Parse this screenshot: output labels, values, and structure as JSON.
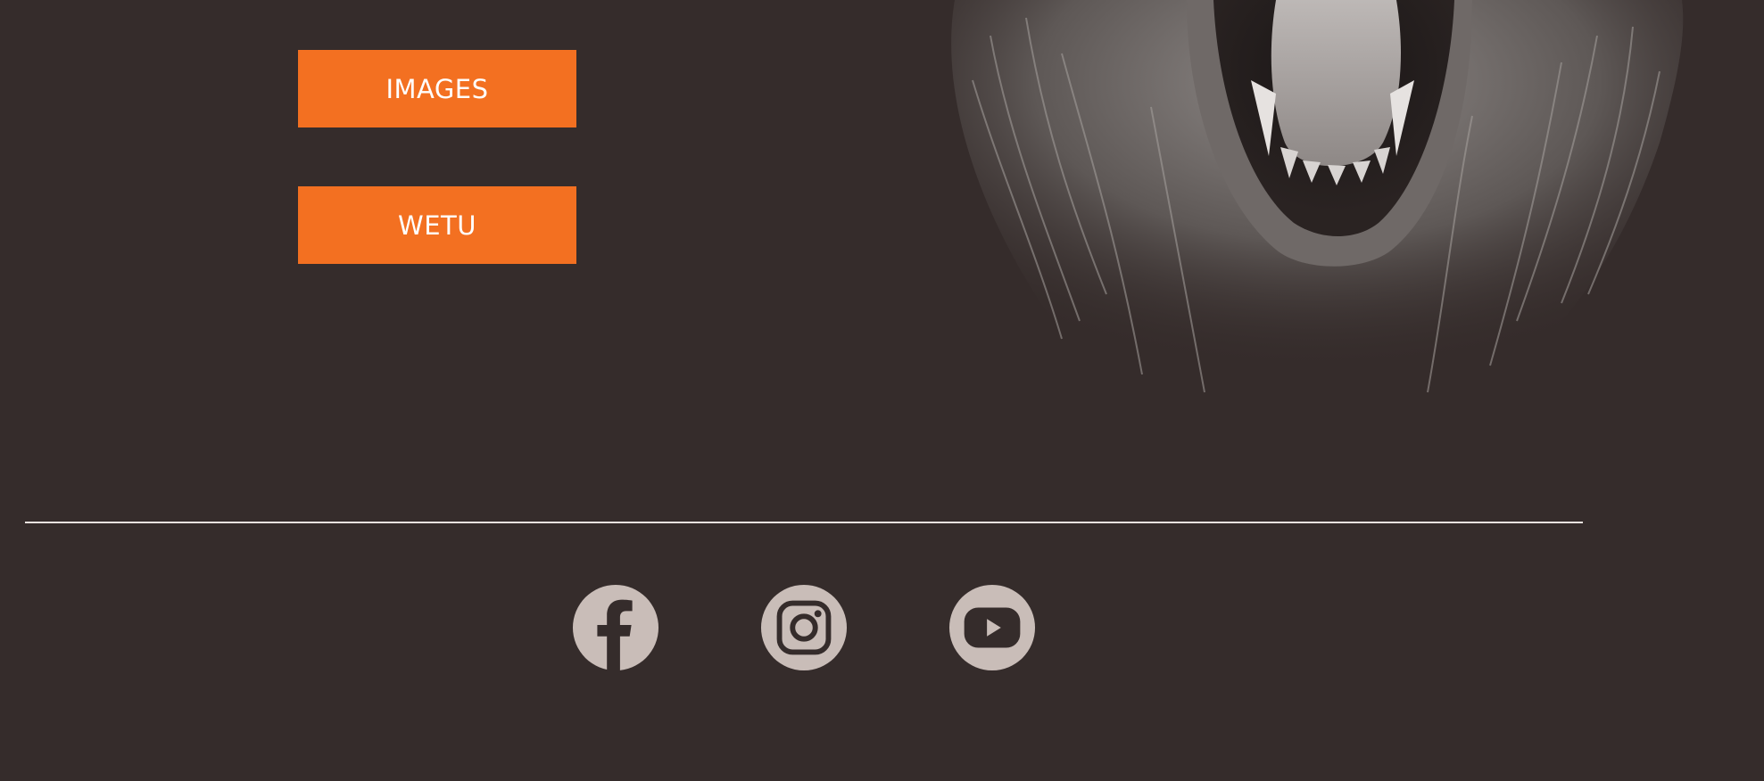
{
  "buttons": {
    "images_label": "IMAGES",
    "wetu_label": "WETU"
  },
  "hero": {
    "icon": "lion-photo"
  },
  "social": [
    {
      "icon": "facebook-icon"
    },
    {
      "icon": "instagram-icon"
    },
    {
      "icon": "youtube-icon"
    }
  ],
  "colors": {
    "background": "#352c2b",
    "accent": "#f37021",
    "icon_fill": "#c9bdb8",
    "divider": "#e8e2df"
  }
}
